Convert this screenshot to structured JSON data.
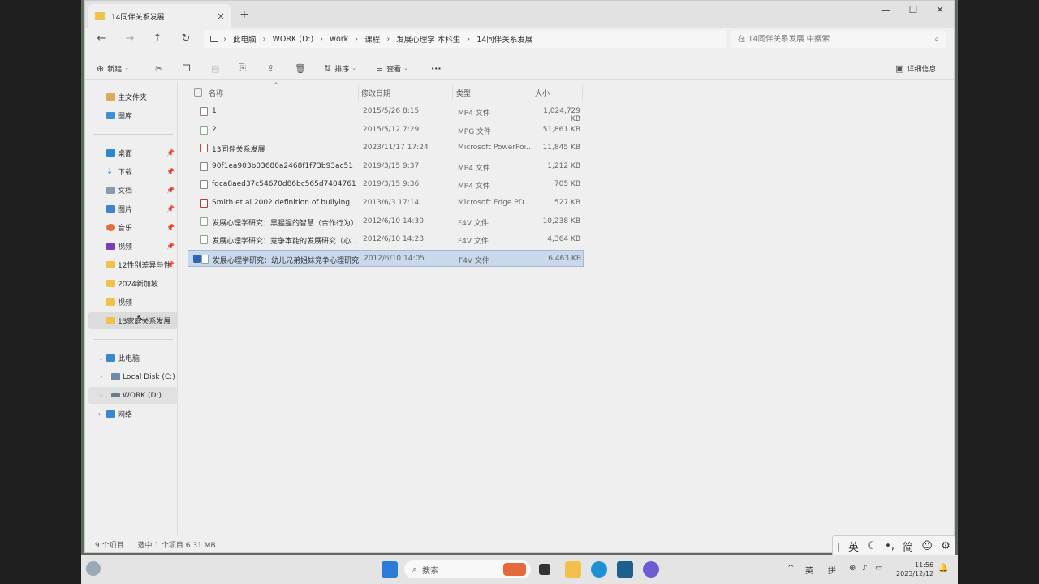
{
  "window": {
    "tab_title": "14同伴关系发展",
    "new_tab": "+",
    "minimize": "—",
    "maximize": "☐",
    "close": "✕"
  },
  "breadcrumb": [
    "此电脑",
    "WORK (D:)",
    "work",
    "课程",
    "发展心理学 本科生",
    "14同伴关系发展"
  ],
  "search": {
    "placeholder": "在 14同伴关系发展 中搜索"
  },
  "toolbar": {
    "new": "新建",
    "sort": "排序",
    "view": "查看",
    "more": "···",
    "details": "详细信息"
  },
  "sidebar": {
    "home": "主文件夹",
    "gallery": "图库",
    "desktop": "桌面",
    "downloads": "下载",
    "documents": "文档",
    "pictures": "图片",
    "music": "音乐",
    "videos": "视频",
    "folder1": "12性别差异与性",
    "folder2": "2024新加坡",
    "folder3": "视频",
    "folder4": "13家庭关系发展",
    "this_pc": "此电脑",
    "disk_c": "Local Disk (C:)",
    "disk_d": "WORK (D:)",
    "network": "网络"
  },
  "columns": {
    "name": "名称",
    "date": "修改日期",
    "type": "类型",
    "size": "大小"
  },
  "files": [
    {
      "name": "1",
      "date": "2015/5/26 8:15",
      "type": "MP4 文件",
      "size": "1,024,729 KB"
    },
    {
      "name": "2",
      "date": "2015/5/12 7:29",
      "type": "MPG 文件",
      "size": "51,861 KB"
    },
    {
      "name": "13同伴关系发展",
      "date": "2023/11/17 17:24",
      "type": "Microsoft PowerPoi...",
      "size": "11,845 KB"
    },
    {
      "name": "90f1ea903b03680a2468f1f73b93ac51",
      "date": "2019/3/15 9:37",
      "type": "MP4 文件",
      "size": "1,212 KB"
    },
    {
      "name": "fdca8aed37c54670d86bc565d7404761",
      "date": "2019/3/15 9:36",
      "type": "MP4 文件",
      "size": "705 KB"
    },
    {
      "name": "Smith et al 2002 definition of bullying",
      "date": "2013/6/3 17:14",
      "type": "Microsoft Edge PD...",
      "size": "527 KB"
    },
    {
      "name": "发展心理学研究：黑猩猩的智慧（合作行为）",
      "date": "2012/6/10 14:30",
      "type": "F4V 文件",
      "size": "10,238 KB"
    },
    {
      "name": "发展心理学研究：竞争本能的发展研究（心...",
      "date": "2012/6/10 14:28",
      "type": "F4V 文件",
      "size": "4,364 KB"
    },
    {
      "name": "发展心理学研究：幼儿兄弟姐妹竞争心理研究",
      "date": "2012/6/10 14:05",
      "type": "F4V 文件",
      "size": "6,463 KB"
    }
  ],
  "status": {
    "count": "9 个项目",
    "selected": "选中 1 个项目  6.31 MB"
  },
  "ime": {
    "lang": "英",
    "punct": "•,",
    "simp": "简"
  },
  "taskbar": {
    "search": "搜索",
    "tray_lang": "英",
    "tray_ime": "拼",
    "time": "11:56",
    "date": "2023/12/12"
  },
  "colors": {
    "selection": "#c9d8ea",
    "accent": "#2f65b5",
    "folder": "#f2c14b"
  }
}
